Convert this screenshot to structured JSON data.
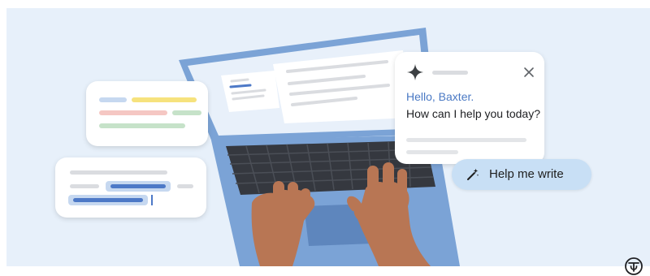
{
  "assistant": {
    "greeting": "Hello, Baxter.",
    "prompt": "How can I help you today?",
    "icon": "sparkle-icon",
    "close_icon": "close-icon"
  },
  "help_button": {
    "label": "Help me write",
    "icon": "pen-sparkle-icon"
  },
  "publisher_logo": {
    "icon": "logo-icon"
  },
  "colors": {
    "background": "#e7f0fa",
    "greeting": "#4a79c4",
    "button": "#c8dff5",
    "laptop": "#7ba3d6",
    "keyboard": "#35383f",
    "skin": "#b87654",
    "placeholder_blue": "#4d79c7",
    "placeholder_yellow": "#f6e27d",
    "placeholder_red": "#f5c7c3",
    "placeholder_green": "#c6e2c9"
  }
}
